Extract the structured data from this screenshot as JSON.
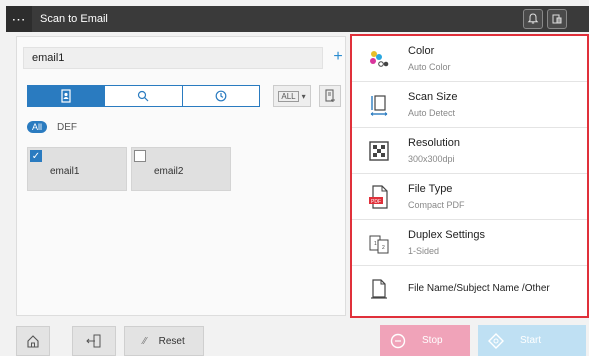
{
  "header": {
    "menu_glyph": "⋯",
    "title": "Scan to Email"
  },
  "address": {
    "value": "email1"
  },
  "index": {
    "all_label": "All",
    "def_label": "DEF"
  },
  "filter": {
    "label": "ALL"
  },
  "destinations": [
    {
      "label": "email1",
      "checked": true
    },
    {
      "label": "email2",
      "checked": false
    }
  ],
  "settings": [
    {
      "title": "Color",
      "sub": "Auto Color",
      "icon": "color-icon"
    },
    {
      "title": "Scan Size",
      "sub": "Auto Detect",
      "icon": "scan-size-icon"
    },
    {
      "title": "Resolution",
      "sub": "300x300dpi",
      "icon": "resolution-icon"
    },
    {
      "title": "File Type",
      "sub": "Compact PDF",
      "icon": "pdf-file-icon"
    },
    {
      "title": "Duplex Settings",
      "sub": "1-Sided",
      "icon": "duplex-icon"
    },
    {
      "title": "File Name/Subject Name /Other",
      "icon": "document-icon"
    }
  ],
  "bottom": {
    "reset_label": "Reset",
    "stop_label": "Stop",
    "start_label": "Start"
  },
  "colors": {
    "accent": "#2a7bc0",
    "highlight_border": "#e0303a",
    "stop": "#f0a3b9",
    "start": "#bfe0f3"
  }
}
